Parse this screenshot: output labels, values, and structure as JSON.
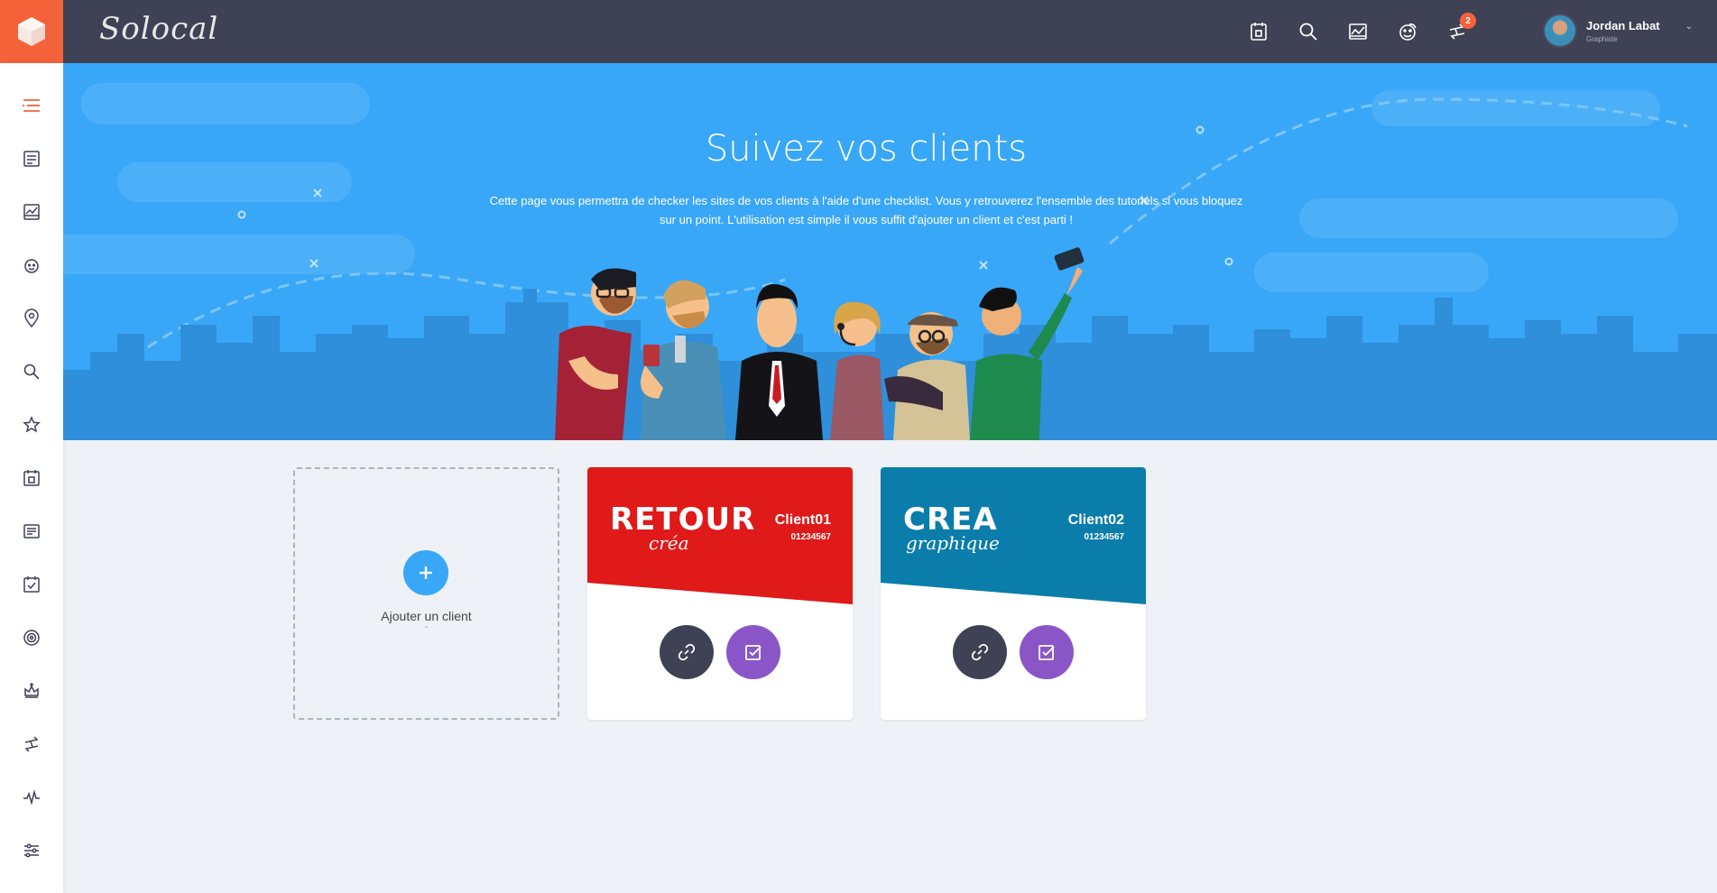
{
  "app": {
    "brand": "Solocal"
  },
  "user": {
    "name": "Jordan Labat",
    "role": "Graphiste"
  },
  "notifications": {
    "count": "2"
  },
  "hero": {
    "title": "Suivez vos clients",
    "description": "Cette page vous permettra de checker les sites de vos clients à l'aide d'une checklist. Vous y retrouverez l'ensemble des tutoriels si vous bloquez sur un point. L'utilisation est simple il vous suffit d'ajouter un client et c'est parti !"
  },
  "add_client": {
    "label": "Ajouter un client",
    "sub": "-"
  },
  "clients": [
    {
      "logo_big": "RETOUR",
      "logo_script": "créa",
      "name": "Client01",
      "code": "01234567",
      "color": "#e01919"
    },
    {
      "logo_big": "CREA",
      "logo_script": "graphique",
      "name": "Client02",
      "code": "01234567",
      "color": "#0a7dab"
    }
  ],
  "colors": {
    "accent": "#f4623a",
    "topbar": "#3f4155",
    "hero": "#39a7f7",
    "check": "#8a56c7"
  },
  "sidebar_icons": [
    "menu-icon",
    "list-icon",
    "chart-icon",
    "face-icon",
    "location-icon",
    "search-icon",
    "star-icon",
    "calendar-icon",
    "news-icon",
    "checklist-icon",
    "target-icon",
    "crown-icon",
    "exchange-icon",
    "pulse-icon",
    "settings-icon"
  ]
}
